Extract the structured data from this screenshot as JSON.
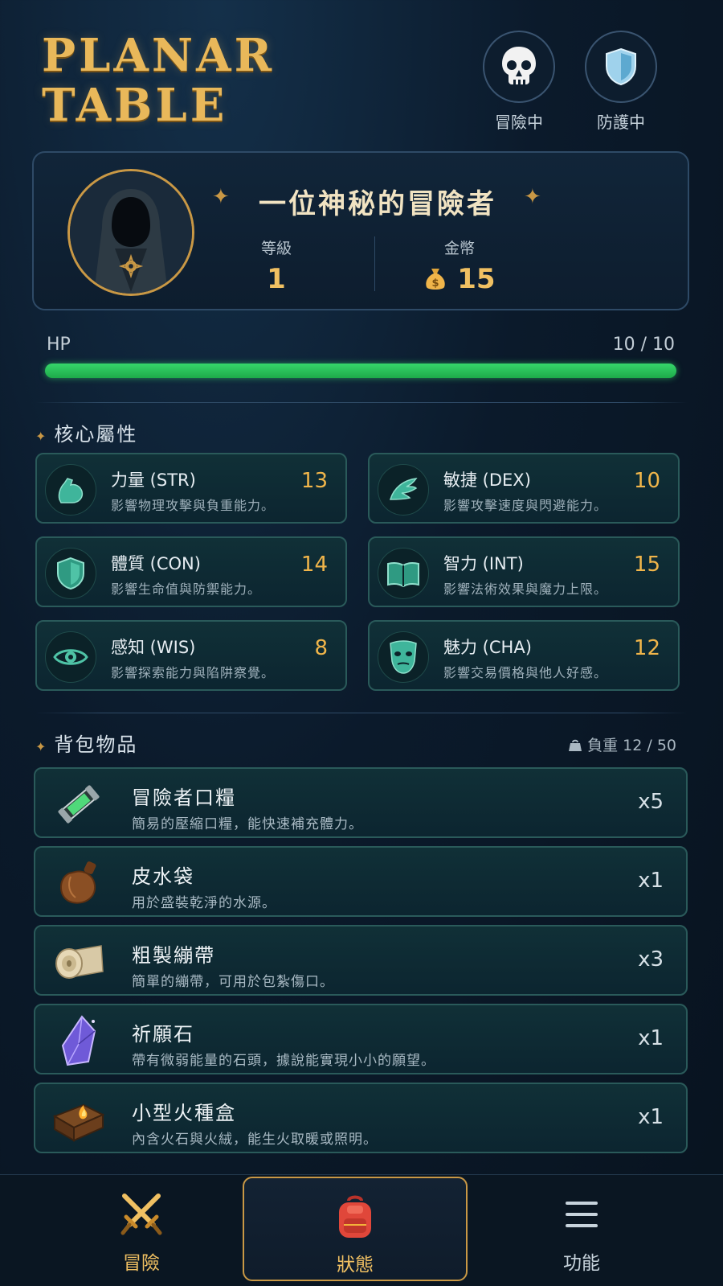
{
  "app": {
    "logo_line1": "PLANAR",
    "logo_line2": "TABLE"
  },
  "status": [
    {
      "label": "冒險中",
      "icon": "skull-icon"
    },
    {
      "label": "防護中",
      "icon": "shield-icon"
    }
  ],
  "profile": {
    "name": "一位神秘的冒險者",
    "level_label": "等級",
    "level": "1",
    "gold_label": "金幣",
    "gold": "15"
  },
  "hp": {
    "label": "HP",
    "current": 10,
    "max": 10,
    "text": "10  /  10",
    "color": "#2fcf62"
  },
  "attributes_section": {
    "title": "核心屬性",
    "items": [
      {
        "name": "力量 (STR)",
        "desc": "影響物理攻擊與負重能力。",
        "value": "13",
        "icon": "muscle-arm-icon"
      },
      {
        "name": "敏捷 (DEX)",
        "desc": "影響攻擊速度與閃避能力。",
        "value": "10",
        "icon": "wing-icon"
      },
      {
        "name": "體質 (CON)",
        "desc": "影響生命值與防禦能力。",
        "value": "14",
        "icon": "shield-icon"
      },
      {
        "name": "智力 (INT)",
        "desc": "影響法術效果與魔力上限。",
        "value": "15",
        "icon": "book-icon"
      },
      {
        "name": "感知 (WIS)",
        "desc": "影響探索能力與陷阱察覺。",
        "value": "8",
        "icon": "eye-icon"
      },
      {
        "name": "魅力 (CHA)",
        "desc": "影響交易價格與他人好感。",
        "value": "12",
        "icon": "mask-icon"
      }
    ]
  },
  "inventory": {
    "title": "背包物品",
    "weight_text": "負重 12 / 50",
    "items": [
      {
        "name": "冒險者口糧",
        "desc": "簡易的壓縮口糧，能快速補充體力。",
        "qty": "x5",
        "icon": "ration-tube-icon"
      },
      {
        "name": "皮水袋",
        "desc": "用於盛裝乾淨的水源。",
        "qty": "x1",
        "icon": "waterskin-icon"
      },
      {
        "name": "粗製繃帶",
        "desc": "簡單的繃帶，可用於包紮傷口。",
        "qty": "x3",
        "icon": "bandage-roll-icon"
      },
      {
        "name": "祈願石",
        "desc": "帶有微弱能量的石頭，據說能實現小小的願望。",
        "qty": "x1",
        "icon": "crystal-icon"
      },
      {
        "name": "小型火種盒",
        "desc": "內含火石與火絨，能生火取暖或照明。",
        "qty": "x1",
        "icon": "tinderbox-icon"
      }
    ]
  },
  "nav": [
    {
      "label": "冒險",
      "icon": "crossed-swords-icon",
      "active": false
    },
    {
      "label": "狀態",
      "icon": "backpack-icon",
      "active": true
    },
    {
      "label": "功能",
      "icon": "menu-icon",
      "active": false
    }
  ],
  "colors": {
    "gold": "#e9b85a",
    "teal_border": "#2a5a5a",
    "value": "#f0b54a"
  }
}
